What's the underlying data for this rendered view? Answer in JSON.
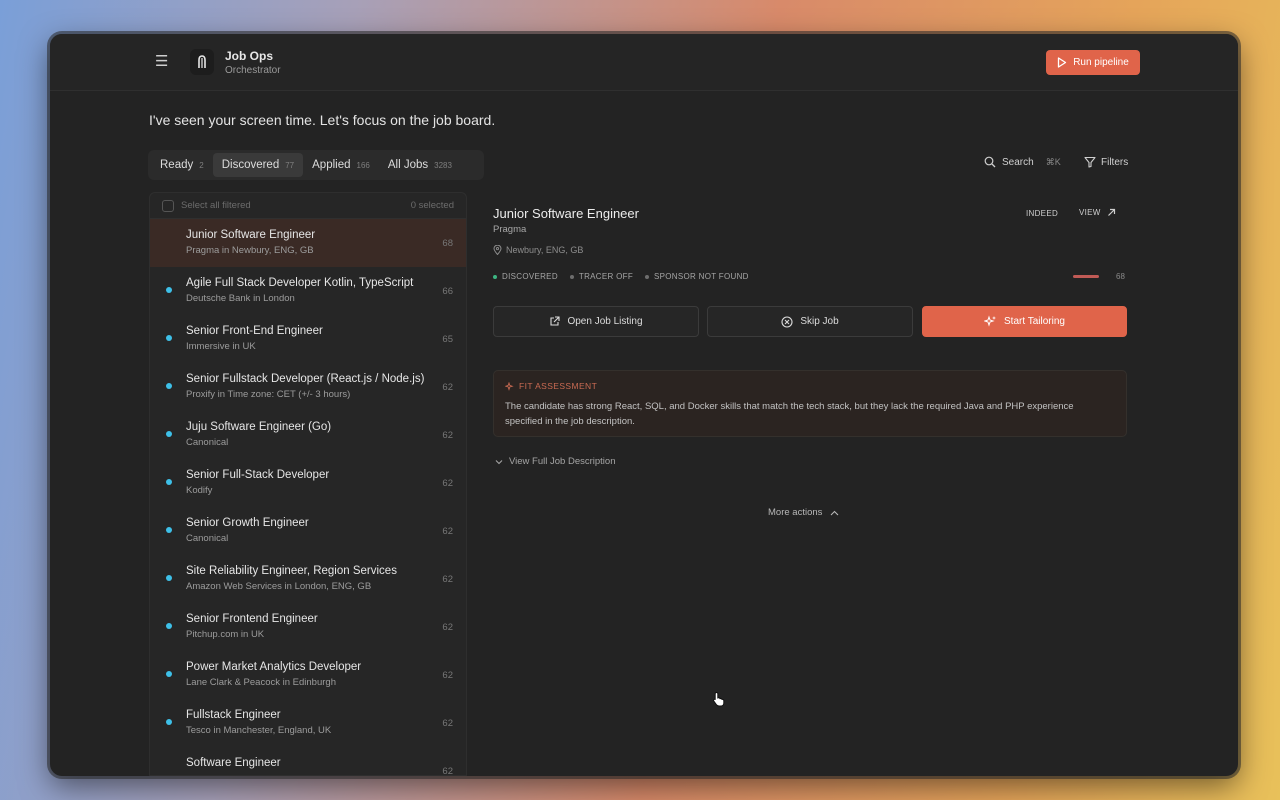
{
  "colors": {
    "accent": "#e0644a",
    "unread_dot": "#3ec0e8",
    "discovered_dot": "#3cb582",
    "background": "#232323"
  },
  "header": {
    "menu_icon": "hamburger-icon",
    "app_name": "Job Ops",
    "app_subtitle": "Orchestrator",
    "run_button_label": "Run pipeline"
  },
  "headline": "I've seen your screen time. Let's focus on the job board.",
  "tabs": [
    {
      "label": "Ready",
      "count": "2"
    },
    {
      "label": "Discovered",
      "count": "77"
    },
    {
      "label": "Applied",
      "count": "166"
    },
    {
      "label": "All Jobs",
      "count": "3283"
    }
  ],
  "toolbar": {
    "search_label": "Search",
    "search_shortcut": "⌘K",
    "filters_label": "Filters"
  },
  "list": {
    "select_all_label": "Select all filtered",
    "selected_count": "0 selected",
    "jobs": [
      {
        "title": "Junior Software Engineer",
        "subtitle": "Pragma in Newbury, ENG, GB",
        "score": "68"
      },
      {
        "title": "Agile Full Stack Developer Kotlin, TypeScript",
        "subtitle": "Deutsche Bank in London",
        "score": "66"
      },
      {
        "title": "Senior Front-End Engineer",
        "subtitle": "Immersive in UK",
        "score": "65"
      },
      {
        "title": "Senior Fullstack Developer (React.js / Node.js)",
        "subtitle": "Proxify in Time zone: CET (+/- 3 hours)",
        "score": "62"
      },
      {
        "title": "Juju Software Engineer (Go)",
        "subtitle": "Canonical",
        "score": "62"
      },
      {
        "title": "Senior Full-Stack Developer",
        "subtitle": "Kodify",
        "score": "62"
      },
      {
        "title": "Senior Growth Engineer",
        "subtitle": "Canonical",
        "score": "62"
      },
      {
        "title": "Site Reliability Engineer, Region Services",
        "subtitle": "Amazon Web Services in London, ENG, GB",
        "score": "62"
      },
      {
        "title": "Senior Frontend Engineer",
        "subtitle": "Pitchup.com in UK",
        "score": "62"
      },
      {
        "title": "Power Market Analytics Developer",
        "subtitle": "Lane Clark & Peacock in Edinburgh",
        "score": "62"
      },
      {
        "title": "Fullstack Engineer",
        "subtitle": "Tesco in Manchester, England, UK",
        "score": "62"
      },
      {
        "title": "Software Engineer",
        "subtitle": "",
        "score": "62"
      }
    ]
  },
  "detail": {
    "title": "Junior Software Engineer",
    "company": "Pragma",
    "source": "INDEED",
    "view_label": "VIEW",
    "location": "Newbury, ENG, GB",
    "statuses": [
      "DISCOVERED",
      "TRACER OFF",
      "SPONSOR NOT FOUND"
    ],
    "score": "68",
    "actions": {
      "open_listing": "Open Job Listing",
      "skip": "Skip Job",
      "tailor": "Start Tailoring"
    },
    "fit": {
      "label": "FIT ASSESSMENT",
      "text": "The candidate has strong React, SQL, and Docker skills that match the tech stack, but they lack the required Java and PHP experience specified in the job description."
    },
    "view_description_label": "View Full Job Description",
    "more_actions_label": "More actions"
  }
}
